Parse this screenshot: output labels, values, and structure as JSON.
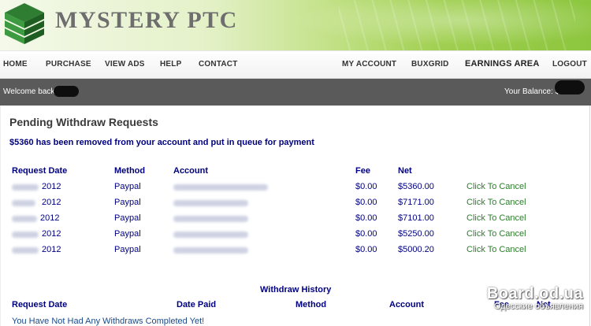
{
  "brand": {
    "name": "MYSTERY PTC"
  },
  "nav": {
    "home": "HOME",
    "purchase": "PURCHASE",
    "view_ads": "VIEW ADS",
    "help": "HELP",
    "contact": "CONTACT",
    "my_account": "MY ACCOUNT",
    "buxgrid": "BUXGRID",
    "earnings_area": "EARNINGS AREA",
    "logout": "LOGOUT"
  },
  "userbar": {
    "welcome": "Welcome back",
    "balance": "Your Balance: $"
  },
  "pending": {
    "title": "Pending Withdraw Requests",
    "notice": "$5360 has been removed from your account and put in queue for payment",
    "headers": {
      "date": "Request Date",
      "method": "Method",
      "account": "Account",
      "fee": "Fee",
      "net": "Net"
    },
    "rows": [
      {
        "year": "2012",
        "method": "Paypal",
        "fee": "$0.00",
        "net": "$5360.00",
        "action": "Click To Cancel"
      },
      {
        "year": "2012",
        "method": "Paypal",
        "fee": "$0.00",
        "net": "$7171.00",
        "action": "Click To Cancel"
      },
      {
        "year": "2012",
        "method": "Paypal",
        "fee": "$0.00",
        "net": "$7101.00",
        "action": "Click To Cancel"
      },
      {
        "year": "2012",
        "method": "Paypal",
        "fee": "$0.00",
        "net": "$5250.00",
        "action": "Click To Cancel"
      },
      {
        "year": "2012",
        "method": "Paypal",
        "fee": "$0.00",
        "net": "$5000.20",
        "action": "Click To Cancel"
      }
    ]
  },
  "history": {
    "title": "Withdraw History",
    "headers": {
      "request_date": "Request Date",
      "date_paid": "Date Paid",
      "method": "Method",
      "account": "Account",
      "fee": "Fee",
      "net": "Net"
    },
    "empty": "You Have Not Had Any Withdraws Completed Yet!"
  },
  "watermark": {
    "line1": "Board.od.ua",
    "line2": "Одесские объявления"
  }
}
